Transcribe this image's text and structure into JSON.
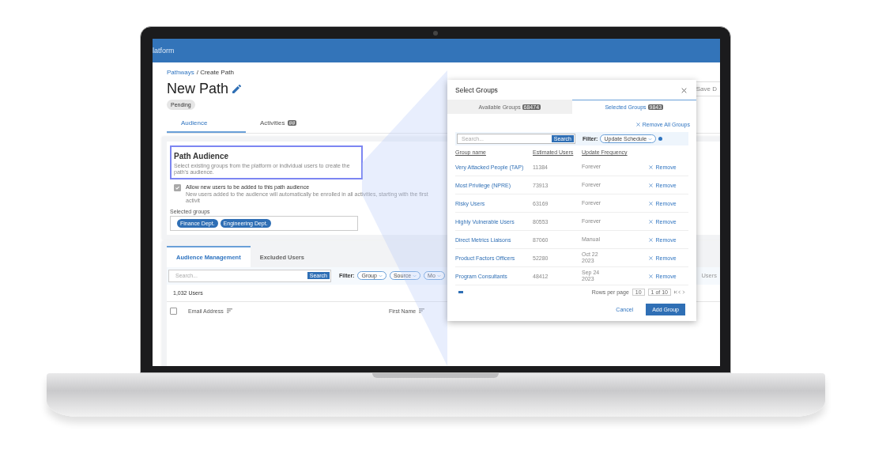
{
  "header": {
    "title": "latform"
  },
  "breadcrumb": {
    "link": "Pathways",
    "current": "/ Create Path"
  },
  "page_title": "New Path",
  "status": "Pending",
  "save_button": "Save D",
  "tabs": [
    {
      "label": "Audience",
      "selected": true
    },
    {
      "label": "Activities",
      "badge": "##",
      "selected": false
    }
  ],
  "path_audience": {
    "title": "Path Audience",
    "description": "Select existing groups from the platform or individual users to create the path's audience.",
    "allow_new": {
      "label": "Allow new users to be added to this path audience",
      "hint": "New users added to the audience will automatically be enrolled in all activities, starting with the first  activit",
      "checked": true
    },
    "selected_groups_label": "Selected groups",
    "chips": [
      "Finance Dept.",
      "Engineering Dept."
    ]
  },
  "management": {
    "tabs": [
      {
        "label": "Audience Management",
        "selected": true
      },
      {
        "label": "Excluded Users",
        "selected": false
      }
    ],
    "search": {
      "placeholder": "Search...",
      "button": "Search"
    },
    "filter_label": "Filter:",
    "filters": [
      "Group",
      "Source",
      "Mo"
    ],
    "count": "1,032 Users",
    "right_text": "Users",
    "select_all_checked": false,
    "columns": [
      "Email Address",
      "First Name"
    ]
  },
  "modal": {
    "title": "Select Groups",
    "tabs": [
      {
        "label": "Available Groups",
        "badge": "68474",
        "selected": false
      },
      {
        "label": "Selected Groups",
        "badge": "9843",
        "selected": true
      }
    ],
    "remove_all": "Remove All Groups",
    "search": {
      "placeholder": "Search...",
      "button": "Search"
    },
    "filter_label": "Filter:",
    "filter": "Update Schedule",
    "columns": [
      "Group name",
      "Estimated Users",
      "Update Frequency"
    ],
    "rows": [
      {
        "name": "Very Attacked People (TAP)",
        "users": "11384",
        "frequency": "Forever",
        "action": "Remove"
      },
      {
        "name": "Most Privilege (NPRE)",
        "users": "73913",
        "frequency": "Forever",
        "action": "Remove"
      },
      {
        "name": "Risky Users",
        "users": "63169",
        "frequency": "Forever",
        "action": "Remove"
      },
      {
        "name": "Highly Vulnerable Users",
        "users": "80553",
        "frequency": "Forever",
        "action": "Remove"
      },
      {
        "name": "Direct Metrics Liaisons",
        "users": "87060",
        "frequency": "Manual",
        "action": "Remove"
      },
      {
        "name": "Product Factors Officers",
        "users": "52280",
        "frequency": "Oct 22 2023",
        "action": "Remove"
      },
      {
        "name": "Program Consultants",
        "users": "48412",
        "frequency": "Sep 24 2023",
        "action": "Remove"
      }
    ],
    "pagination": {
      "rows_label": "Rows per page",
      "rows_value": "10",
      "page": "1 of 10"
    },
    "cancel": "Cancel",
    "submit": "Add Group"
  }
}
